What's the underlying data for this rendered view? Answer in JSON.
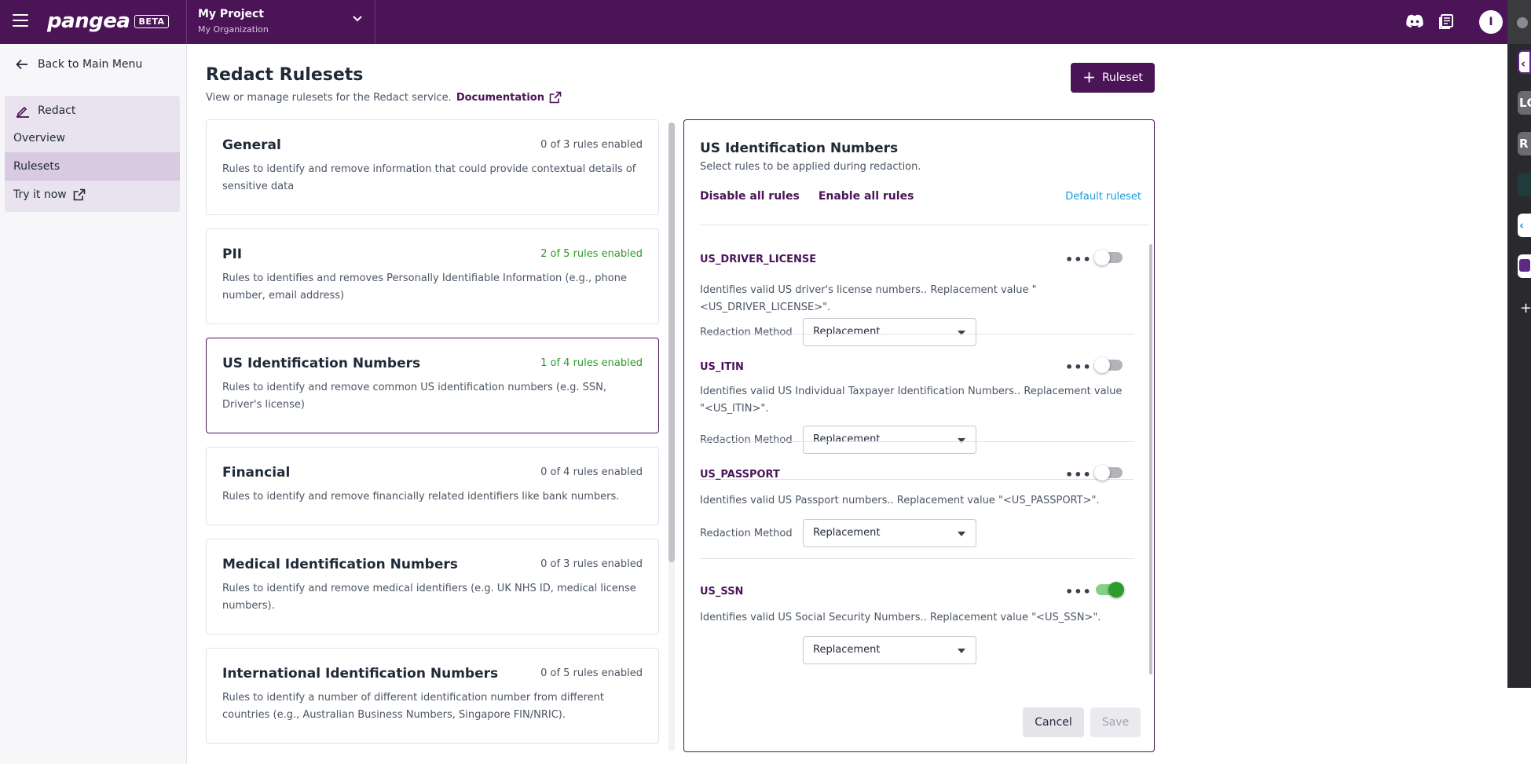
{
  "topbar": {
    "logo": "pangea",
    "beta_badge": "BETA",
    "project_name": "My Project",
    "organization": "My Organization",
    "avatar_initial": "I"
  },
  "sidebar": {
    "back_label": "Back to Main Menu",
    "service_label": "Redact",
    "items": [
      {
        "label": "Overview",
        "active": false
      },
      {
        "label": "Rulesets",
        "active": true
      },
      {
        "label": "Try it now",
        "active": false
      }
    ]
  },
  "page": {
    "title": "Redact Rulesets",
    "subtitle": "View or manage rulesets for the Redact service.",
    "doc_link": "Documentation",
    "add_button": "Ruleset"
  },
  "rulesets": [
    {
      "name": "General",
      "count": "0 of 3 rules enabled",
      "has_enabled": false,
      "selected": false,
      "description": "Rules to identify and remove information that could provide contextual details of sensitive data"
    },
    {
      "name": "PII",
      "count": "2 of 5 rules enabled",
      "has_enabled": true,
      "selected": false,
      "description": "Rules to identifies and removes Personally Identifiable Information (e.g., phone number, email address)"
    },
    {
      "name": "US Identification Numbers",
      "count": "1 of 4 rules enabled",
      "has_enabled": true,
      "selected": true,
      "description": "Rules to identify and remove common US identification numbers (e.g. SSN, Driver's license)"
    },
    {
      "name": "Financial",
      "count": "0 of 4 rules enabled",
      "has_enabled": false,
      "selected": false,
      "description": "Rules to identify and remove financially related identifiers like bank numbers."
    },
    {
      "name": "Medical Identification Numbers",
      "count": "0 of 3 rules enabled",
      "has_enabled": false,
      "selected": false,
      "description": "Rules to identify and remove medical identifiers (e.g. UK NHS ID, medical license numbers)."
    },
    {
      "name": "International Identification Numbers",
      "count": "0 of 5 rules enabled",
      "has_enabled": false,
      "selected": false,
      "description": "Rules to identify a number of different identification number from different countries (e.g., Australian Business Numbers, Singapore FIN/NRIC)."
    }
  ],
  "detail": {
    "title": "US Identification Numbers",
    "subtitle": "Select rules to be applied during redaction.",
    "disable_all": "Disable all rules",
    "enable_all": "Enable all rules",
    "default_ruleset": "Default ruleset",
    "method_label": "Redaction Method",
    "rules": [
      {
        "name": "US_DRIVER_LICENSE",
        "enabled": false,
        "description": "Identifies valid US driver's license numbers.. Replacement value \"<US_DRIVER_LICENSE>\".",
        "method": "Replacement"
      },
      {
        "name": "US_ITIN",
        "enabled": false,
        "description": "Identifies valid US Individual Taxpayer Identification Numbers.. Replacement value \"<US_ITIN>\".",
        "method": "Replacement"
      },
      {
        "name": "US_PASSPORT",
        "enabled": false,
        "description": "Identifies valid US Passport numbers.. Replacement value \"<US_PASSPORT>\".",
        "method": "Replacement"
      },
      {
        "name": "US_SSN",
        "enabled": true,
        "description": "Identifies valid US Social Security Numbers.. Replacement value \"<US_SSN>\".",
        "method": "Replacement"
      }
    ],
    "cancel": "Cancel",
    "save": "Save"
  },
  "edge_tiles": [
    "LC",
    "R"
  ],
  "colors": {
    "brand": "#4a1457",
    "enabled_green": "#2c9c2c",
    "link_blue": "#1d9bd6"
  }
}
